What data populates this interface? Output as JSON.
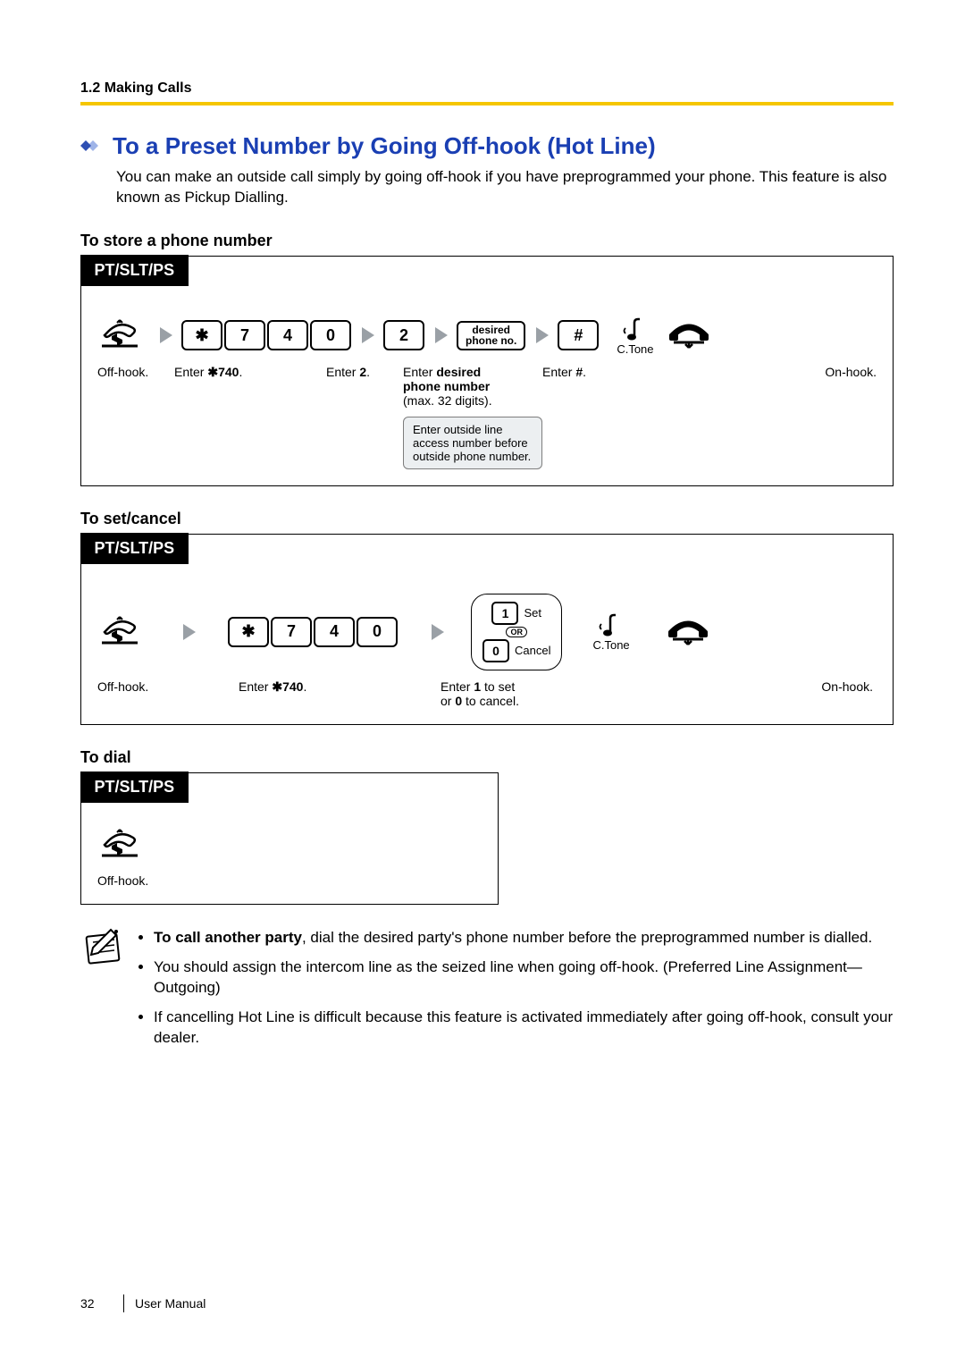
{
  "header": {
    "breadcrumb": "1.2 Making Calls"
  },
  "title": "To a Preset Number by Going Off-hook (Hot Line)",
  "intro": "You can make an outside call simply by going off-hook if you have preprogrammed your phone. This feature is also known as Pickup Dialling.",
  "section1": {
    "heading": "To store a phone number",
    "tab": "PT/SLT/PS",
    "keys": {
      "star": "✱",
      "k7": "7",
      "k4": "4",
      "k0": "0",
      "k2": "2"
    },
    "desired_l1": "desired",
    "desired_l2": "phone no.",
    "hash": "#",
    "ctone": "C.Tone",
    "cap_offhook": "Off-hook.",
    "cap_enter740_a": "Enter ",
    "cap_enter740_b": "✱740",
    "cap_enter740_c": ".",
    "cap_enter2_a": "Enter ",
    "cap_enter2_b": "2",
    "cap_enter2_c": ".",
    "cap_desired_a": "Enter ",
    "cap_desired_b": "desired",
    "cap_desired_c": "phone number",
    "cap_desired_d": "(max. 32 digits).",
    "cap_hash_a": "Enter ",
    "cap_hash_b": "#",
    "cap_hash_c": ".",
    "cap_onhook": "On-hook.",
    "note": "Enter outside line access number before outside phone number."
  },
  "section2": {
    "heading": "To set/cancel",
    "tab": "PT/SLT/PS",
    "keys": {
      "star": "✱",
      "k7": "7",
      "k4": "4",
      "k0": "0",
      "k1": "1"
    },
    "set_label": "Set",
    "or_label": "OR",
    "cancel_key": "0",
    "cancel_label": "Cancel",
    "ctone": "C.Tone",
    "cap_offhook": "Off-hook.",
    "cap_enter740_a": "Enter ",
    "cap_enter740_b": "✱740",
    "cap_enter740_c": ".",
    "cap_choice_a": "Enter ",
    "cap_choice_b": "1",
    "cap_choice_c": " to set",
    "cap_choice_d": "or ",
    "cap_choice_e": "0",
    "cap_choice_f": " to cancel.",
    "cap_onhook": "On-hook."
  },
  "section3": {
    "heading": "To dial",
    "tab": "PT/SLT/PS",
    "cap_offhook": "Off-hook."
  },
  "notes": {
    "n1_b": "To call another party",
    "n1": ", dial the desired party's phone number before the preprogrammed number is dialled.",
    "n2": "You should assign the intercom line as the seized line when going off-hook. (Preferred Line Assignment—Outgoing)",
    "n3": "If cancelling Hot Line is difficult because this feature is activated immediately after going off-hook, consult your dealer."
  },
  "footer": {
    "page": "32",
    "label": "User Manual"
  }
}
